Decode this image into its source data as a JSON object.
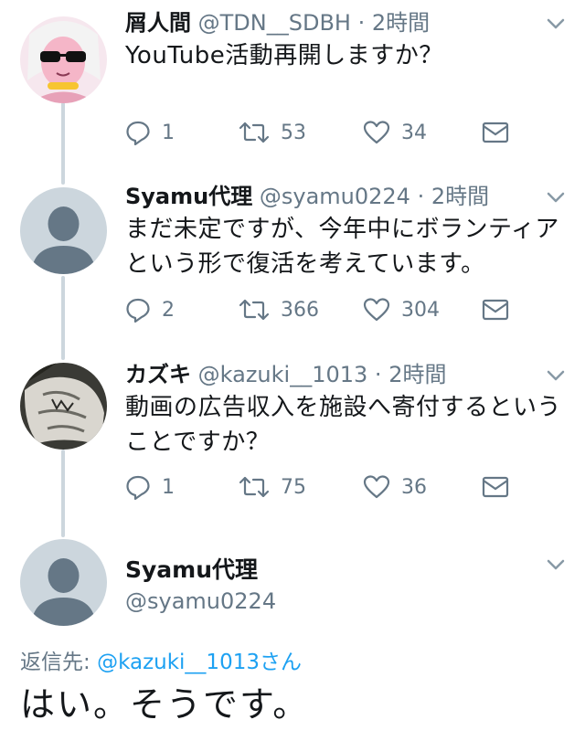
{
  "colors": {
    "accent": "#1da1f2",
    "muted": "#657786",
    "thread_line": "#ccd6dd"
  },
  "tweets": [
    {
      "name": "屑人間",
      "handle": "@TDN__SDBH",
      "dot": "·",
      "time": "2時間",
      "text_lines": [
        "YouTube活動再開しますか？"
      ],
      "reply_count": "1",
      "retweet_count": "53",
      "like_count": "34",
      "avatar_icon": "anime-character-avatar"
    },
    {
      "name": "Syamu代理",
      "handle": "@syamu0224",
      "dot": "·",
      "time": "2時間",
      "text_lines": [
        "まだ未定ですが、今年中にボランティア",
        "という形で復活を考えています。"
      ],
      "reply_count": "2",
      "retweet_count": "366",
      "like_count": "304",
      "avatar_icon": "default-profile-avatar"
    },
    {
      "name": "カズキ",
      "handle": "@kazuki__1013",
      "dot": "·",
      "time": "2時間",
      "text_lines": [
        "動画の広告収入を施設へ寄付するという",
        "ことですか？"
      ],
      "reply_count": "1",
      "retweet_count": "75",
      "like_count": "36",
      "avatar_icon": "photo-avatar"
    }
  ],
  "main_tweet": {
    "name": "Syamu代理",
    "handle": "@syamu0224",
    "reply_label": "返信先:",
    "reply_mention": "@kazuki__1013さん",
    "text": "はい。そうです。"
  }
}
